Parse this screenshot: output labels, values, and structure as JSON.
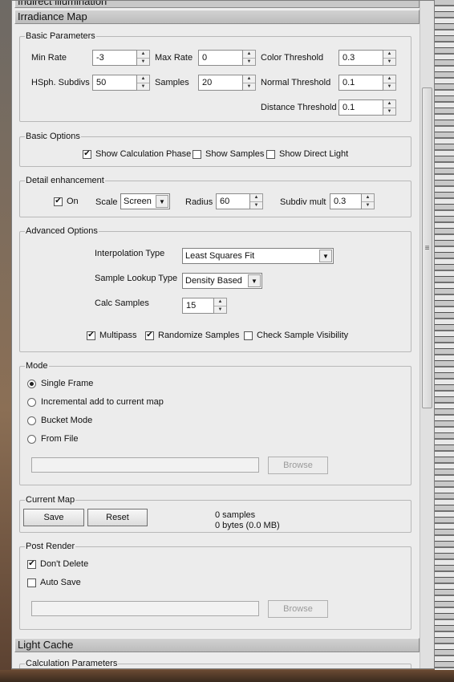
{
  "rollouts": {
    "indirect_illumination": "Indirect illumination",
    "irradiance_map": "Irradiance Map",
    "light_cache": "Light Cache",
    "calculation_parameters": "Calculation Parameters"
  },
  "basic_parameters": {
    "title": "Basic Parameters",
    "min_rate": {
      "label": "Min Rate",
      "value": "-3"
    },
    "max_rate": {
      "label": "Max Rate",
      "value": "0"
    },
    "color_threshold": {
      "label": "Color Threshold",
      "value": "0.3"
    },
    "hsph_subdivs": {
      "label": "HSph. Subdivs",
      "value": "50"
    },
    "samples": {
      "label": "Samples",
      "value": "20"
    },
    "normal_threshold": {
      "label": "Normal Threshold",
      "value": "0.1"
    },
    "distance_threshold": {
      "label": "Distance Threshold",
      "value": "0.1"
    }
  },
  "basic_options": {
    "title": "Basic Options",
    "show_calc_phase": {
      "label": "Show Calculation Phase",
      "checked": true
    },
    "show_samples": {
      "label": "Show Samples",
      "checked": false
    },
    "show_direct_light": {
      "label": "Show Direct Light",
      "checked": false
    }
  },
  "detail_enhancement": {
    "title": "Detail enhancement",
    "on": {
      "label": "On",
      "checked": true
    },
    "scale_label": "Scale",
    "scale_value": "Screen",
    "radius": {
      "label": "Radius",
      "value": "60"
    },
    "subdiv_mult": {
      "label": "Subdiv mult",
      "value": "0.3"
    }
  },
  "advanced_options": {
    "title": "Advanced Options",
    "interpolation_type": {
      "label": "Interpolation Type",
      "value": "Least Squares Fit"
    },
    "sample_lookup_type": {
      "label": "Sample Lookup Type",
      "value": "Density Based"
    },
    "calc_samples": {
      "label": "Calc Samples",
      "value": "15"
    },
    "multipass": {
      "label": "Multipass",
      "checked": true
    },
    "randomize_samples": {
      "label": "Randomize Samples",
      "checked": true
    },
    "check_sample_visibility": {
      "label": "Check Sample Visibility",
      "checked": false
    }
  },
  "mode": {
    "title": "Mode",
    "options": [
      "Single Frame",
      "Incremental add to current map",
      "Bucket Mode",
      "From File"
    ],
    "selected": "Single Frame",
    "browse_label": "Browse"
  },
  "current_map": {
    "title": "Current Map",
    "save_label": "Save",
    "reset_label": "Reset",
    "samples_text": "0 samples",
    "bytes_text": "0 bytes (0.0 MB)"
  },
  "post_render": {
    "title": "Post Render",
    "dont_delete": {
      "label": "Don't Delete",
      "checked": true
    },
    "auto_save": {
      "label": "Auto Save",
      "checked": false
    },
    "browse_label": "Browse"
  },
  "icons": {
    "check": "✔",
    "arrow_up": "▲",
    "arrow_down": "▼",
    "dropdown": "▼",
    "grip": "≡"
  }
}
